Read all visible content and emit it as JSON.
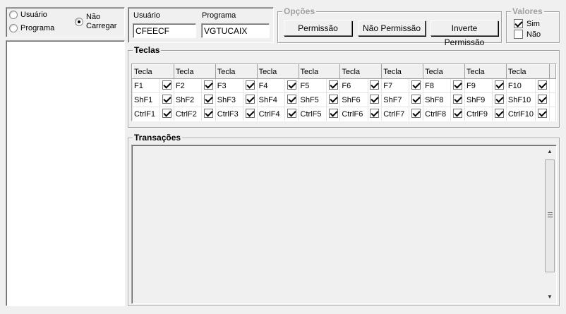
{
  "filter": {
    "options": [
      {
        "label": "Usuário",
        "checked": false
      },
      {
        "label": "Programa",
        "checked": false
      },
      {
        "label": "Não Carregar",
        "checked": true
      }
    ]
  },
  "usuario": {
    "label": "Usuário",
    "value": "CFEECF"
  },
  "programa": {
    "label": "Programa",
    "value": "VGTUCAIX"
  },
  "opcoes": {
    "title": "Opções",
    "buttons": [
      "Permissão",
      "Não Permissão",
      "Inverte Permissão"
    ]
  },
  "valores": {
    "title": "Valores",
    "options": [
      {
        "label": "Sim",
        "checked": true
      },
      {
        "label": "Não",
        "checked": false
      }
    ]
  },
  "teclas": {
    "title": "Teclas",
    "header": "Tecla",
    "rows": [
      [
        "F1",
        "F2",
        "F3",
        "F4",
        "F5",
        "F6",
        "F7",
        "F8",
        "F9",
        "F10"
      ],
      [
        "ShF1",
        "ShF2",
        "ShF3",
        "ShF4",
        "ShF5",
        "ShF6",
        "ShF7",
        "ShF8",
        "ShF9",
        "ShF10"
      ],
      [
        "CtrlF1",
        "CtrlF2",
        "CtrlF3",
        "CtrlF4",
        "CtrlF5",
        "CtrlF6",
        "CtrlF7",
        "CtrlF8",
        "CtrlF9",
        "CtrlF10"
      ]
    ],
    "all_checked": true
  },
  "transacoes": {
    "title": "Transações",
    "scroll_up_icon": "arrow-up-icon",
    "scroll_down_icon": "arrow-down-icon",
    "grip_icon": "grip-icon"
  }
}
